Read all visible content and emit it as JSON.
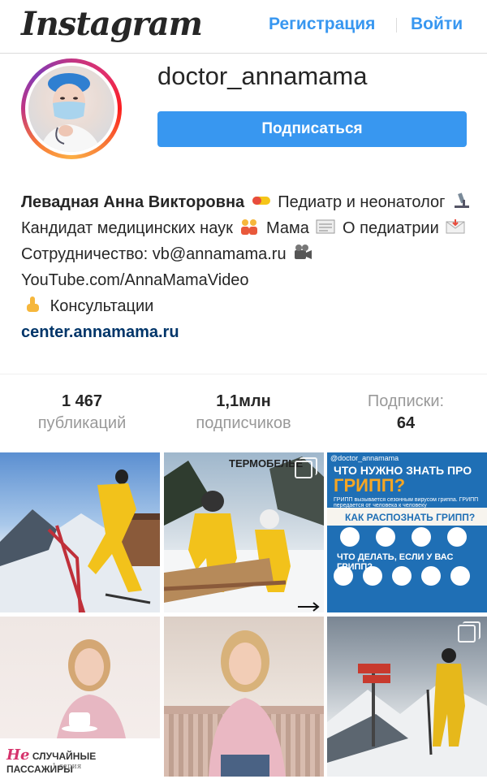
{
  "header": {
    "logo": "Instagram",
    "register": "Регистрация",
    "login": "Войти"
  },
  "profile": {
    "username": "doctor_annamama",
    "follow_button": "Подписаться",
    "avatar_icon": "doctor-avatar"
  },
  "bio": {
    "name": "Левадная Анна Викторовна",
    "segments": [
      "Педиатр и неонатолог",
      "Кандидат медицинских наук",
      "Мама",
      "О педиатрии",
      "Сотрудничество: vb@annamama.ru",
      "YouTube.com/AnnaMamaVideo",
      "Консультации"
    ],
    "link": "center.annamama.ru"
  },
  "stats": {
    "posts_value": "1 467",
    "posts_label": "публикаций",
    "followers_value": "1,1млн",
    "followers_label": "подписчиков",
    "following_label": "Подписки:",
    "following_value": "64"
  },
  "posts": {
    "p2_title": "ТЕРМОБЕЛЬЕ",
    "p3_handle": "@doctor_annamama",
    "p3_title_line1": "ЧТО НУЖНО ЗНАТЬ ПРО",
    "p3_title_line2": "ГРИПП?",
    "p3_subtitle": "ГРИПП вызывается сезонным вирусом гриппа. ГРИПП передается от человека к человеку",
    "p3_question1": "КАК РАСПОЗНАТЬ ГРИПП?",
    "p3_question2": "ЧТО ДЕЛАТЬ, ЕСЛИ У ВАС ГРИПП?",
    "p4_caption_prefix": "Не",
    "p4_caption": "СЛУЧАЙНЫЕ ПАССАЖИРЫ",
    "p4_caption2": "1 серия"
  },
  "colors": {
    "accent": "#3897f0",
    "link": "#003569",
    "muted": "#999999",
    "text": "#262626"
  }
}
